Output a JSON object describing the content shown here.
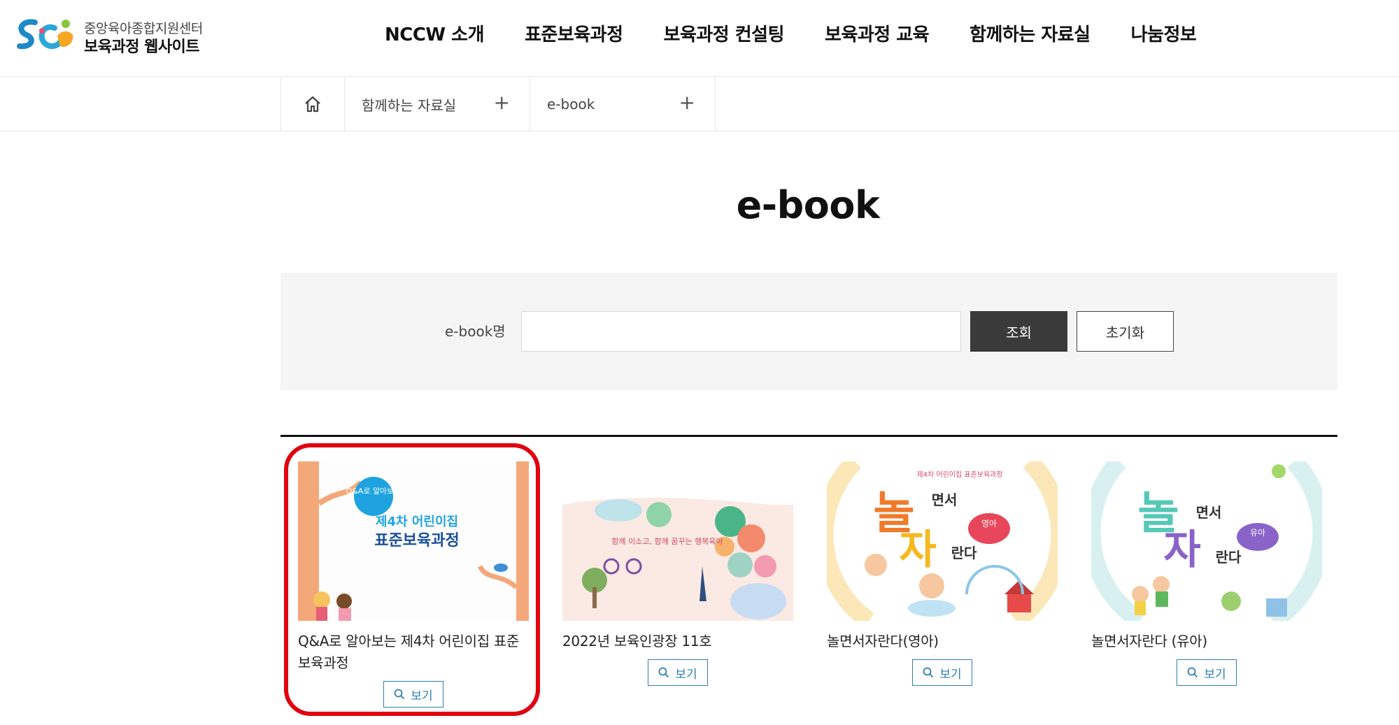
{
  "logo": {
    "subtitle": "중앙육아종합지원센터",
    "title": "보육과정 웹사이트"
  },
  "nav": {
    "items": [
      "NCCW 소개",
      "표준보육과정",
      "보육과정 컨설팅",
      "보육과정 교육",
      "함께하는 자료실",
      "나눔정보"
    ]
  },
  "breadcrumb": {
    "level1": "함께하는 자료실",
    "level2": "e-book",
    "expand_symbol": "+"
  },
  "page": {
    "title": "e-book"
  },
  "search": {
    "label": "e-book명",
    "value": "",
    "placeholder": "",
    "search_button": "조회",
    "reset_button": "초기화"
  },
  "cards": [
    {
      "title": "Q&A로 알아보는 제4차 어린이집 표준보육과정",
      "view_label": "보기",
      "cover": {
        "badge": "Q&A로 알아보는",
        "line1": "제4차 어린이집",
        "line2": "표준보육과정"
      }
    },
    {
      "title": "2022년 보육인광장 11호",
      "view_label": "보기",
      "cover": {
        "caption": "함께 이소고, 함께 꿈꾸는 행복육아"
      }
    },
    {
      "title": "놀면서자란다(영아)",
      "view_label": "보기",
      "cover": {
        "top": "제4차 어린이집 표준보육과정",
        "big1": "놀",
        "small1": "면서",
        "big2": "자",
        "small2": "란다",
        "bubble": "영아"
      }
    },
    {
      "title": "놀면서자란다 (유아)",
      "view_label": "보기",
      "cover": {
        "big1": "놀",
        "small1": "면서",
        "big2": "자",
        "small2": "란다",
        "bubble": "유아"
      }
    }
  ],
  "colors": {
    "accent_red": "#e0000f",
    "button_dark": "#3a3a3a",
    "view_button": "#2e7fb0"
  }
}
